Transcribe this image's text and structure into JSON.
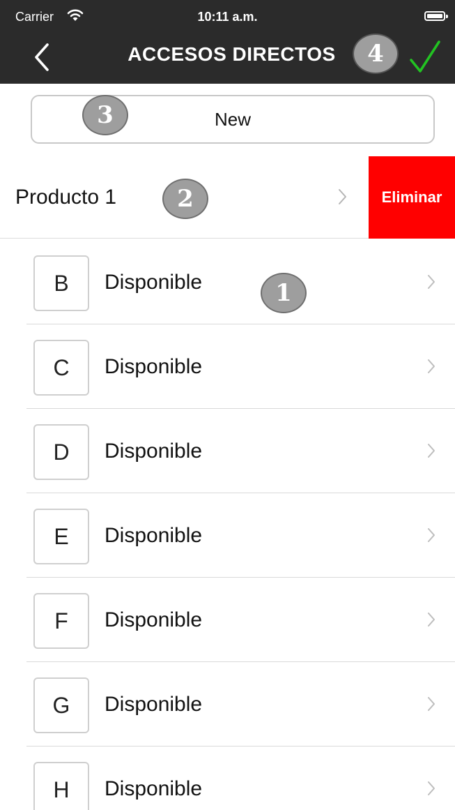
{
  "status_bar": {
    "carrier": "Carrier",
    "time": "10:11 a.m."
  },
  "nav": {
    "title": "ACCESOS DIRECTOS",
    "back_icon": "chevron-left-icon",
    "confirm_icon": "checkmark-icon",
    "confirm_color": "#22c322"
  },
  "actions": {
    "new_label": "New"
  },
  "product": {
    "label": "Producto 1",
    "delete_label": "Eliminar",
    "delete_color": "#ff0000"
  },
  "items": [
    {
      "letter": "B",
      "label": "Disponible"
    },
    {
      "letter": "C",
      "label": "Disponible"
    },
    {
      "letter": "D",
      "label": "Disponible"
    },
    {
      "letter": "E",
      "label": "Disponible"
    },
    {
      "letter": "F",
      "label": "Disponible"
    },
    {
      "letter": "G",
      "label": "Disponible"
    },
    {
      "letter": "H",
      "label": "Disponible"
    }
  ],
  "annotations": [
    "1",
    "2",
    "3",
    "4"
  ]
}
